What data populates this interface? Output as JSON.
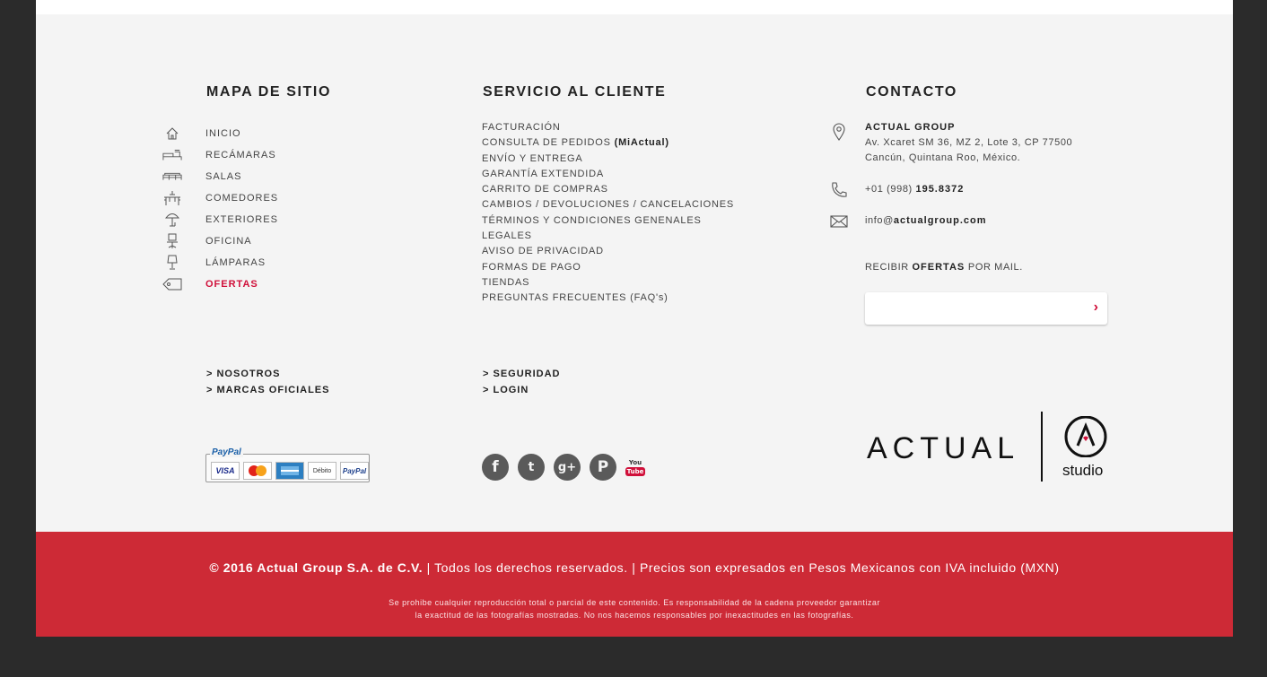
{
  "site_map": {
    "heading": "MAPA DE SITIO",
    "items": [
      {
        "label": "INICIO",
        "icon": "home-icon"
      },
      {
        "label": "RECÁMARAS",
        "icon": "bed-icon"
      },
      {
        "label": "SALAS",
        "icon": "sofa-icon"
      },
      {
        "label": "COMEDORES",
        "icon": "dining-table-icon"
      },
      {
        "label": "EXTERIORES",
        "icon": "umbrella-icon"
      },
      {
        "label": "OFICINA",
        "icon": "office-chair-icon"
      },
      {
        "label": "LÁMPARAS",
        "icon": "lamp-icon"
      },
      {
        "label": "OFERTAS",
        "icon": "tag-icon"
      }
    ]
  },
  "customer_service": {
    "heading": "SERVICIO AL CLIENTE",
    "items": [
      "FACTURACIÓN",
      "CONSULTA DE PEDIDOS",
      "ENVÍO Y ENTREGA",
      "GARANTÍA EXTENDIDA",
      "CARRITO DE COMPRAS",
      "CAMBIOS / DEVOLUCIONES / CANCELACIONES",
      "TÉRMINOS Y CONDICIONES GENENALES",
      "LEGALES",
      "AVISO DE PRIVACIDAD",
      "FORMAS DE PAGO",
      "TIENDAS",
      "PREGUNTAS FRECUENTES (FAQ's)"
    ],
    "orders_suffix": "(MiActual)"
  },
  "contact": {
    "heading": "CONTACTO",
    "company": "ACTUAL GROUP",
    "address_1": "Av. Xcaret SM 36, MZ 2, Lote 3, CP 77500",
    "address_2": "Cancún, Quintana Roo, México.",
    "phone_prefix": "+01 (998)",
    "phone_number": "195.8372",
    "email_user": "info@",
    "email_domain": "actualgroup.com",
    "newsletter_pre": "RECIBIR",
    "newsletter_bold": "OFERTAS",
    "newsletter_post": "POR MAIL.",
    "newsletter_input": "",
    "submit_label": "›"
  },
  "extra_links": {
    "col1": [
      "> NOSOTROS",
      "> MARCAS OFICIALES"
    ],
    "col2": [
      "> SEGURIDAD",
      "> LOGIN"
    ]
  },
  "payments": {
    "title": "PayPal",
    "cards": [
      "VISA",
      "MasterCard",
      "AMEX",
      "Débito",
      "PayPal"
    ]
  },
  "social": [
    "facebook-icon",
    "twitter-icon",
    "google-plus-icon",
    "pinterest-icon",
    "youtube-icon"
  ],
  "social_labels": {
    "youtube_top": "You",
    "youtube_bottom": "Tube"
  },
  "brand": {
    "wordmark": "ACTUAL",
    "studio": "studio"
  },
  "copyright": {
    "bold": "© 2016 Actual Group S.A. de C.V.",
    "rest": " | Todos los derechos reservados. | Precios son expresados en Pesos Mexicanos con IVA incluido (MXN)",
    "disclaimer_1": "Se prohibe cualquier reproducción total o parcial de este contenido. Es responsabilidad de la cadena proveedor garantizar",
    "disclaimer_2": "la exactitud de las fotografías mostradas. No nos hacemos responsables por inexactitudes en las fotografías."
  },
  "colors": {
    "accent": "#d0103a",
    "footer_bar": "#cd2a36",
    "background": "#f4f4f4",
    "page_bg": "#2b2b2b"
  }
}
